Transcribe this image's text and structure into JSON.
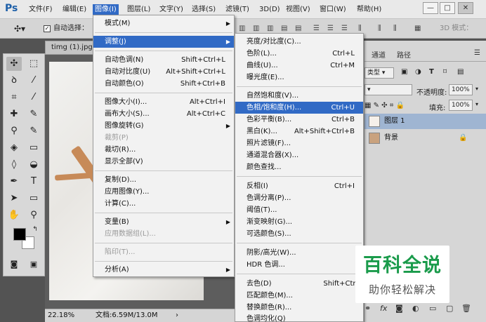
{
  "menubar": {
    "logo": "Ps",
    "items": [
      "文件(F)",
      "编辑(E)",
      "图像(I)",
      "图层(L)",
      "文字(Y)",
      "选择(S)",
      "滤镜(T)",
      "3D(D)",
      "视图(V)",
      "窗口(W)",
      "帮助(H)"
    ],
    "active_index": 2,
    "window_minimize": "—",
    "window_restore": "□",
    "window_close": "✕"
  },
  "options_bar": {
    "auto_select_label": "自动选择：",
    "mode_3d_label": "3D 模式："
  },
  "document": {
    "tab_title": "timg (1).jpg",
    "zoom": "22.18%",
    "doc_info": "文档:6.59M/13.0M"
  },
  "panels": {
    "tabs": [
      "通道",
      "路径"
    ],
    "opacity_label": "不透明度:",
    "opacity_value": "100%",
    "fill_label": "填充:",
    "fill_value": "100%",
    "kind_label": "类型",
    "layers": [
      {
        "name": "图层 1",
        "selected": true
      },
      {
        "name": "背景",
        "selected": false,
        "locked": true
      }
    ]
  },
  "image_menu": {
    "items": [
      {
        "label": "模式(M)",
        "shortcut": "",
        "submenu": true,
        "disabled": false,
        "highlight": false
      },
      {
        "label": "调整(J)",
        "shortcut": "",
        "submenu": true,
        "disabled": false,
        "highlight": true
      },
      {
        "label": "自动色调(N)",
        "shortcut": "Shift+Ctrl+L",
        "submenu": false,
        "disabled": false,
        "highlight": false
      },
      {
        "label": "自动对比度(U)",
        "shortcut": "Alt+Shift+Ctrl+L",
        "submenu": false,
        "disabled": false,
        "highlight": false
      },
      {
        "label": "自动颜色(O)",
        "shortcut": "Shift+Ctrl+B",
        "submenu": false,
        "disabled": false,
        "highlight": false
      },
      {
        "label": "图像大小(I)...",
        "shortcut": "Alt+Ctrl+I",
        "submenu": false,
        "disabled": false,
        "highlight": false
      },
      {
        "label": "画布大小(S)...",
        "shortcut": "Alt+Ctrl+C",
        "submenu": false,
        "disabled": false,
        "highlight": false
      },
      {
        "label": "图像旋转(G)",
        "shortcut": "",
        "submenu": true,
        "disabled": false,
        "highlight": false
      },
      {
        "label": "裁剪(P)",
        "shortcut": "",
        "submenu": false,
        "disabled": true,
        "highlight": false
      },
      {
        "label": "裁切(R)...",
        "shortcut": "",
        "submenu": false,
        "disabled": false,
        "highlight": false
      },
      {
        "label": "显示全部(V)",
        "shortcut": "",
        "submenu": false,
        "disabled": false,
        "highlight": false
      },
      {
        "label": "复制(D)...",
        "shortcut": "",
        "submenu": false,
        "disabled": false,
        "highlight": false
      },
      {
        "label": "应用图像(Y)...",
        "shortcut": "",
        "submenu": false,
        "disabled": false,
        "highlight": false
      },
      {
        "label": "计算(C)...",
        "shortcut": "",
        "submenu": false,
        "disabled": false,
        "highlight": false
      },
      {
        "label": "变量(B)",
        "shortcut": "",
        "submenu": true,
        "disabled": false,
        "highlight": false
      },
      {
        "label": "应用数据组(L)...",
        "shortcut": "",
        "submenu": false,
        "disabled": true,
        "highlight": false
      },
      {
        "label": "陷印(T)...",
        "shortcut": "",
        "submenu": false,
        "disabled": true,
        "highlight": false
      },
      {
        "label": "分析(A)",
        "shortcut": "",
        "submenu": true,
        "disabled": false,
        "highlight": false
      }
    ]
  },
  "adjust_menu": {
    "items": [
      {
        "label": "亮度/对比度(C)...",
        "shortcut": "",
        "highlight": false
      },
      {
        "label": "色阶(L)...",
        "shortcut": "Ctrl+L",
        "highlight": false
      },
      {
        "label": "曲线(U)...",
        "shortcut": "Ctrl+M",
        "highlight": false
      },
      {
        "label": "曝光度(E)...",
        "shortcut": "",
        "highlight": false
      },
      {
        "label": "自然饱和度(V)...",
        "shortcut": "",
        "highlight": false
      },
      {
        "label": "色相/饱和度(H)...",
        "shortcut": "Ctrl+U",
        "highlight": true
      },
      {
        "label": "色彩平衡(B)...",
        "shortcut": "Ctrl+B",
        "highlight": false
      },
      {
        "label": "黑白(K)...",
        "shortcut": "Alt+Shift+Ctrl+B",
        "highlight": false
      },
      {
        "label": "照片滤镜(F)...",
        "shortcut": "",
        "highlight": false
      },
      {
        "label": "通道混合器(X)...",
        "shortcut": "",
        "highlight": false
      },
      {
        "label": "颜色查找...",
        "shortcut": "",
        "highlight": false
      },
      {
        "label": "反相(I)",
        "shortcut": "Ctrl+I",
        "highlight": false
      },
      {
        "label": "色调分离(P)...",
        "shortcut": "",
        "highlight": false
      },
      {
        "label": "阈值(T)...",
        "shortcut": "",
        "highlight": false
      },
      {
        "label": "渐变映射(G)...",
        "shortcut": "",
        "highlight": false
      },
      {
        "label": "可选颜色(S)...",
        "shortcut": "",
        "highlight": false
      },
      {
        "label": "阴影/高光(W)...",
        "shortcut": "",
        "highlight": false
      },
      {
        "label": "HDR 色调...",
        "shortcut": "",
        "highlight": false
      },
      {
        "label": "去色(D)",
        "shortcut": "Shift+Ctrl+U",
        "highlight": false
      },
      {
        "label": "匹配颜色(M)...",
        "shortcut": "",
        "highlight": false
      },
      {
        "label": "替换颜色(R)...",
        "shortcut": "",
        "highlight": false
      },
      {
        "label": "色调均化(Q)",
        "shortcut": "",
        "highlight": false
      }
    ]
  },
  "watermark": {
    "title": "百科全说",
    "subtitle": "助你轻松解决"
  },
  "colors": {
    "highlight": "#316ac5",
    "watermark_green": "#1a9b4b",
    "workspace": "#535353"
  }
}
